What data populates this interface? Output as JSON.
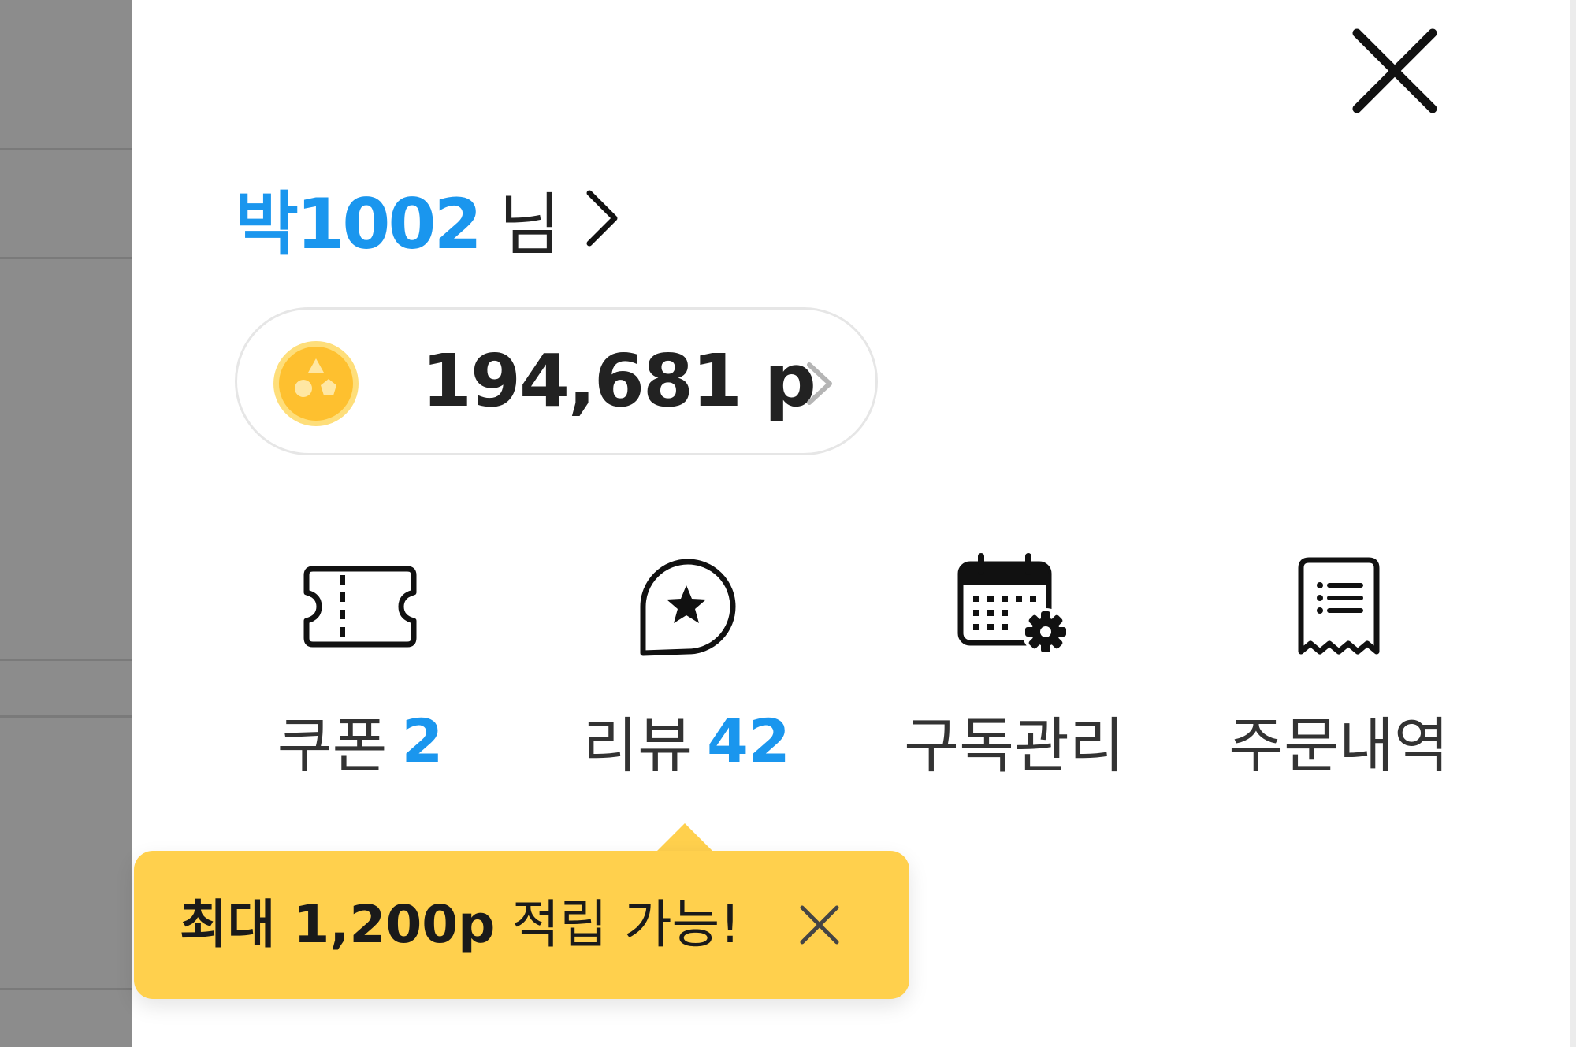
{
  "drawer": {
    "close_icon": "close-icon",
    "user": {
      "name": "박1002",
      "suffix": "님",
      "chevron_icon": "chevron-right-icon",
      "name_color": "#1a96ee"
    },
    "points": {
      "value": "194,681 p",
      "coin_icon": "point-coin-icon",
      "chevron_icon": "chevron-right-icon",
      "coin_color": "#fec02f"
    },
    "quick_menu": [
      {
        "label": "쿠폰",
        "count": "2",
        "icon": "coupon-ticket-icon"
      },
      {
        "label": "리뷰",
        "count": "42",
        "icon": "review-star-bubble-icon"
      },
      {
        "label": "구독관리",
        "icon": "calendar-settings-icon"
      },
      {
        "label": "주문내역",
        "icon": "receipt-icon"
      }
    ],
    "tooltip": {
      "emphasis": "최대 1,200p",
      "rest": " 적립 가능!",
      "close_icon": "close-icon",
      "background": "#ffd04d"
    },
    "accent_color": "#1a96ee"
  }
}
